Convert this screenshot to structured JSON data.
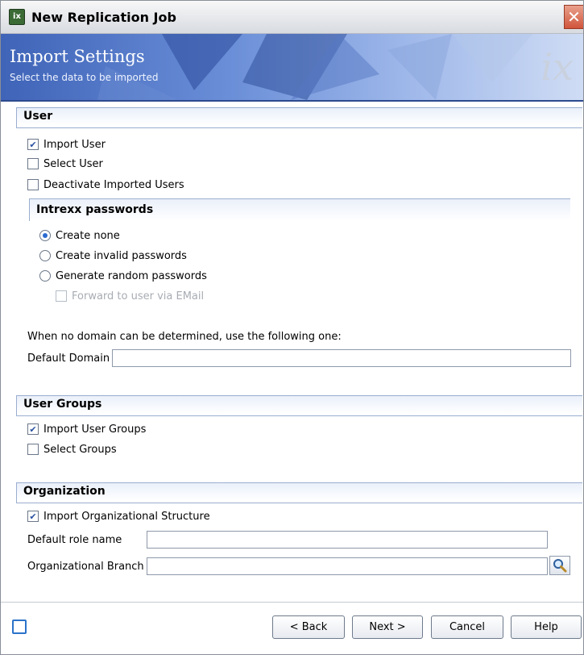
{
  "window": {
    "title": "New Replication Job",
    "app_icon_text": "ix"
  },
  "banner": {
    "title": "Import Settings",
    "subtitle": "Select the data to be imported",
    "logo": "ix"
  },
  "user_section": {
    "header": "User",
    "import_user": {
      "label": "Import User",
      "checked": true
    },
    "select_user": {
      "label": "Select User",
      "checked": false
    },
    "deactivate_users": {
      "label": "Deactivate Imported Users",
      "checked": false
    },
    "passwords": {
      "title": "Intrexx passwords",
      "options": [
        "Create none",
        "Create invalid passwords",
        "Generate random passwords"
      ],
      "selected_index": 0,
      "forward_email": {
        "label": "Forward to user via EMail",
        "checked": false,
        "disabled": true
      }
    },
    "domain_note": "When no domain can be determined, use the following one:",
    "default_domain_label": "Default Domain",
    "default_domain_value": ""
  },
  "groups_section": {
    "header": "User Groups",
    "import_groups": {
      "label": "Import User Groups",
      "checked": true
    },
    "select_groups": {
      "label": "Select Groups",
      "checked": false
    }
  },
  "org_section": {
    "header": "Organization",
    "import_org": {
      "label": "Import Organizational Structure",
      "checked": true
    },
    "default_role_label": "Default role name",
    "default_role_value": "",
    "org_branch_label": "Organizational Branch",
    "org_branch_value": ""
  },
  "footer": {
    "back": "< Back",
    "next": "Next >",
    "cancel": "Cancel",
    "help": "Help"
  },
  "colors": {
    "banner": "#3f64b8",
    "accent": "#2a52a0",
    "section_border": "#9aaed0"
  }
}
